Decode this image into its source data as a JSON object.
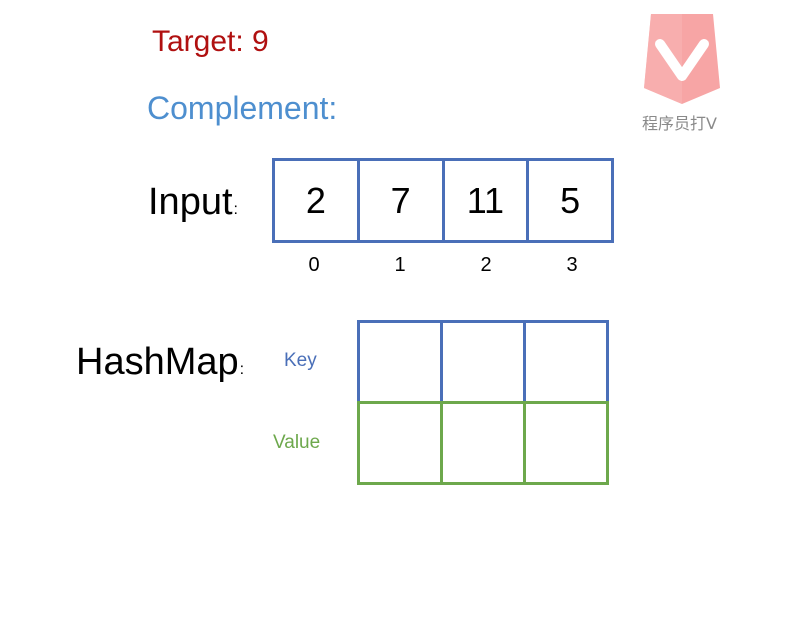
{
  "target": {
    "text": "Target: 9"
  },
  "complement": {
    "text": "Complement:"
  },
  "input": {
    "label": "Input",
    "colon": ":",
    "values": [
      "2",
      "7",
      "11",
      "5"
    ],
    "indices": [
      "0",
      "1",
      "2",
      "3"
    ]
  },
  "hashmap": {
    "label": "HashMap",
    "colon": ":",
    "key_label": "Key",
    "value_label": "Value",
    "key_cells": [
      "",
      "",
      ""
    ],
    "value_cells": [
      "",
      "",
      ""
    ]
  },
  "logo": {
    "caption": "程序员打V",
    "icon": "v-logo-icon"
  },
  "colors": {
    "target": "#b01010",
    "complement": "#4e8fcf",
    "key": "#4a6fb8",
    "value": "#6da84c",
    "logo": "#f7a5a5"
  }
}
